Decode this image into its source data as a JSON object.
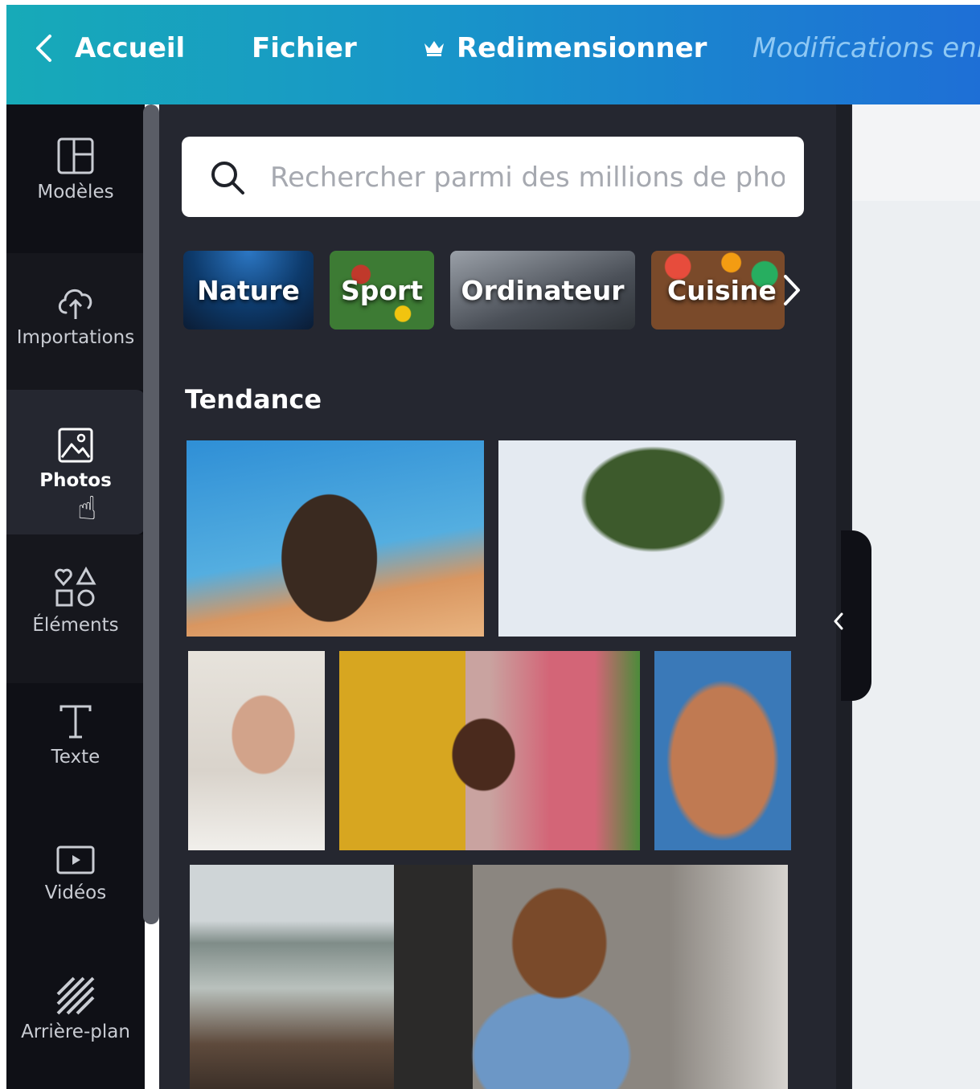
{
  "topbar": {
    "back_label": "Accueil",
    "file_label": "Fichier",
    "resize_label": "Redimensionner",
    "status_text": "Modifications enr"
  },
  "sidebar": {
    "items": [
      {
        "label": "Modèles",
        "icon": "templates-icon"
      },
      {
        "label": "Importations",
        "icon": "upload-cloud-icon"
      },
      {
        "label": "Photos",
        "icon": "photo-icon"
      },
      {
        "label": "Éléments",
        "icon": "shapes-icon"
      },
      {
        "label": "Texte",
        "icon": "text-icon"
      },
      {
        "label": "Vidéos",
        "icon": "video-icon"
      },
      {
        "label": "Arrière-plan",
        "icon": "background-pattern-icon"
      }
    ],
    "active_label": "Photos"
  },
  "panel": {
    "search": {
      "placeholder": "Rechercher parmi des millions de phot",
      "value": ""
    },
    "categories": [
      "Nature",
      "Sport",
      "Ordinateur",
      "Cuisine"
    ],
    "section_title": "Tendance"
  },
  "colors": {
    "topbar_start": "#17aab8",
    "topbar_end": "#1e6fd6",
    "rail_bg": "#0f1016",
    "panel_bg": "#252730"
  }
}
